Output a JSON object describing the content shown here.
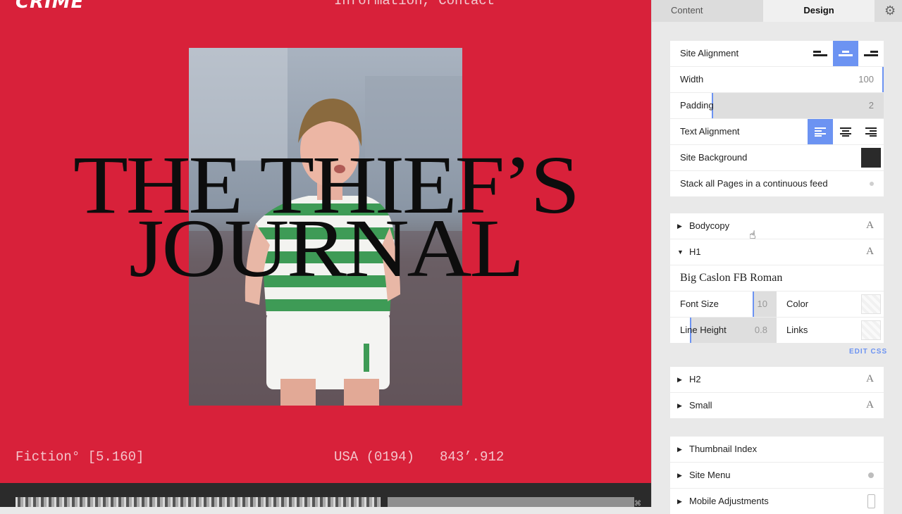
{
  "site": {
    "logo": "CRIME",
    "nav": "Information, Contact",
    "headline_line1": "THE THIEF’S",
    "headline_line2": "JOURNAL",
    "footer_left": "Fiction° [5.160]",
    "footer_mid_1": "USA (0194)",
    "footer_mid_2": "843’.912",
    "colors": {
      "background": "#d8213a",
      "headline": "#0d0d0d"
    }
  },
  "panel": {
    "tabs": {
      "content": "Content",
      "design": "Design"
    },
    "site": {
      "site_alignment_label": "Site Alignment",
      "width_label": "Width",
      "width_value": "100",
      "padding_label": "Padding",
      "padding_value": "2",
      "text_alignment_label": "Text Alignment",
      "site_background_label": "Site Background",
      "stack_pages_label": "Stack all Pages in a continuous feed"
    },
    "typography": {
      "bodycopy_label": "Bodycopy",
      "h1_label": "H1",
      "h1_font": "Big Caslon FB Roman",
      "font_size_label": "Font Size",
      "font_size_value": "10",
      "color_label": "Color",
      "line_height_label": "Line Height",
      "line_height_value": "0.8",
      "links_label": "Links",
      "edit_css": "EDIT CSS",
      "h2_label": "H2",
      "small_label": "Small",
      "type_glyph": "A"
    },
    "sections": {
      "thumbnail_index": "Thumbnail Index",
      "site_menu": "Site Menu",
      "mobile_adjustments": "Mobile Adjustments"
    },
    "accent_color": "#6c93f2"
  }
}
